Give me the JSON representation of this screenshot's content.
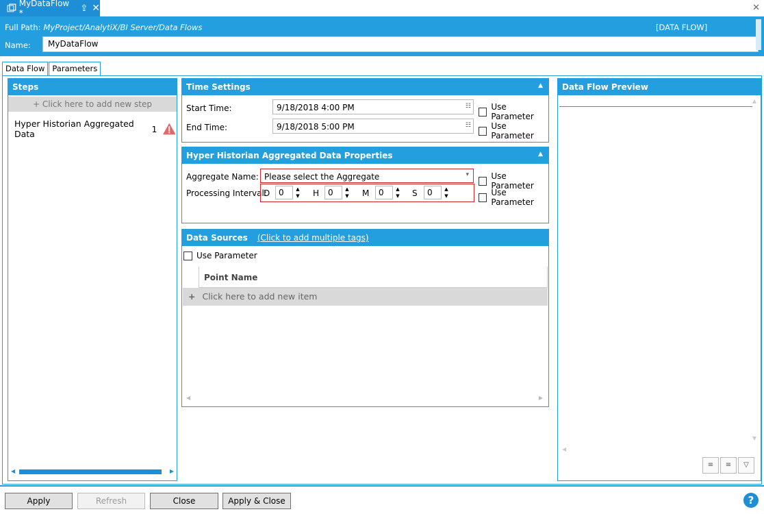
{
  "doc_tab": {
    "title": "MyDataFlow *"
  },
  "header": {
    "full_path_label": "Full Path:",
    "full_path_value": "MyProject/AnalytiX/BI Server/Data Flows",
    "kind": "[DATA FLOW]",
    "name_label": "Name:",
    "name_value": "MyDataFlow"
  },
  "tabs": [
    {
      "label": "Data Flow"
    },
    {
      "label": "Parameters"
    }
  ],
  "steps": {
    "title": "Steps",
    "add_label": "+  Click here to add new step",
    "items": [
      {
        "label": "Hyper Historian Aggregated Data",
        "count": "1"
      }
    ]
  },
  "time_settings": {
    "title": "Time Settings",
    "start_label": "Start Time:",
    "start_value": "9/18/2018 4:00 PM",
    "end_label": "End Time:",
    "end_value": "9/18/2018 5:00 PM",
    "use_parameter": "Use Parameter"
  },
  "hh_props": {
    "title": "Hyper Historian Aggregated Data Properties",
    "aggregate_label": "Aggregate Name:",
    "aggregate_value": "Please select the Aggregate",
    "interval_label": "Processing Interval:",
    "interval": {
      "D": "0",
      "H": "0",
      "M": "0",
      "S": "0"
    },
    "d_label": "D",
    "h_label": "H",
    "m_label": "M",
    "s_label": "S",
    "use_parameter": "Use Parameter"
  },
  "data_sources": {
    "title": "Data Sources",
    "link": "(Click to add multiple tags)",
    "use_parameter": "Use Parameter",
    "column": "Point Name",
    "add_item": "Click here to add new item"
  },
  "preview": {
    "title": "Data Flow Preview"
  },
  "buttons": {
    "apply": "Apply",
    "refresh": "Refresh",
    "close": "Close",
    "apply_close": "Apply & Close"
  },
  "help": "?"
}
